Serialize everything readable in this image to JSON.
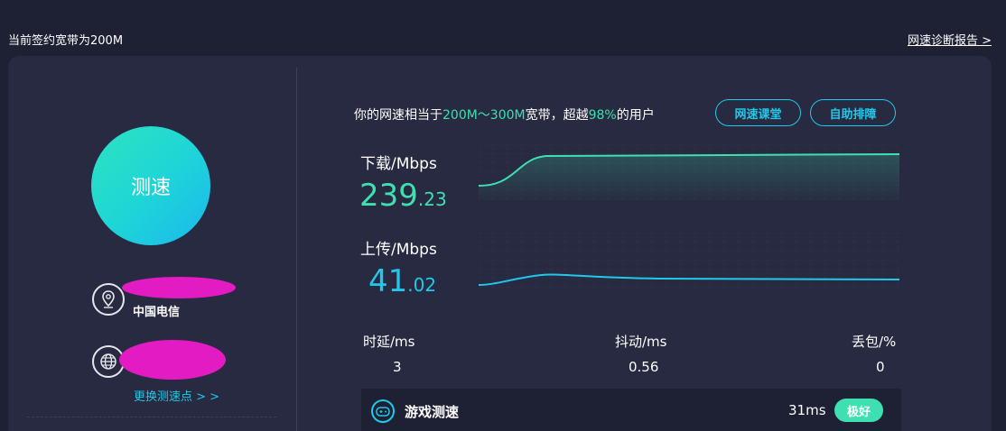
{
  "header": {
    "bandwidth_text": "当前签约宽带为200M",
    "report_link": "网速诊断报告 >"
  },
  "left": {
    "speed_button": "测速",
    "location_icon": "location-pin-icon",
    "isp": "中国电信",
    "globe_icon": "globe-icon",
    "change_node": "更换测速点 > >"
  },
  "summary": {
    "prefix": "你的网速相当于",
    "range": "200M～300M",
    "mid": "宽带，超越",
    "percent": "98%",
    "suffix": "的用户"
  },
  "buttons": {
    "course": "网速课堂",
    "troubleshoot": "自助排障"
  },
  "download": {
    "label": "下载/Mbps",
    "int": "239",
    "dec": ".23"
  },
  "upload": {
    "label": "上传/Mbps",
    "int": "41",
    "dec": ".02"
  },
  "stats": {
    "latency_label": "时延/ms",
    "latency_value": "3",
    "jitter_label": "抖动/ms",
    "jitter_value": "0.56",
    "loss_label": "丢包/%",
    "loss_value": "0"
  },
  "game": {
    "icon": "gamepad-icon",
    "label": "游戏测速",
    "ms": "31ms",
    "badge": "极好"
  },
  "colors": {
    "accent_green": "#3ee0b2",
    "accent_cyan": "#20c8ea",
    "background": "#1e2033",
    "card": "#272a40"
  }
}
